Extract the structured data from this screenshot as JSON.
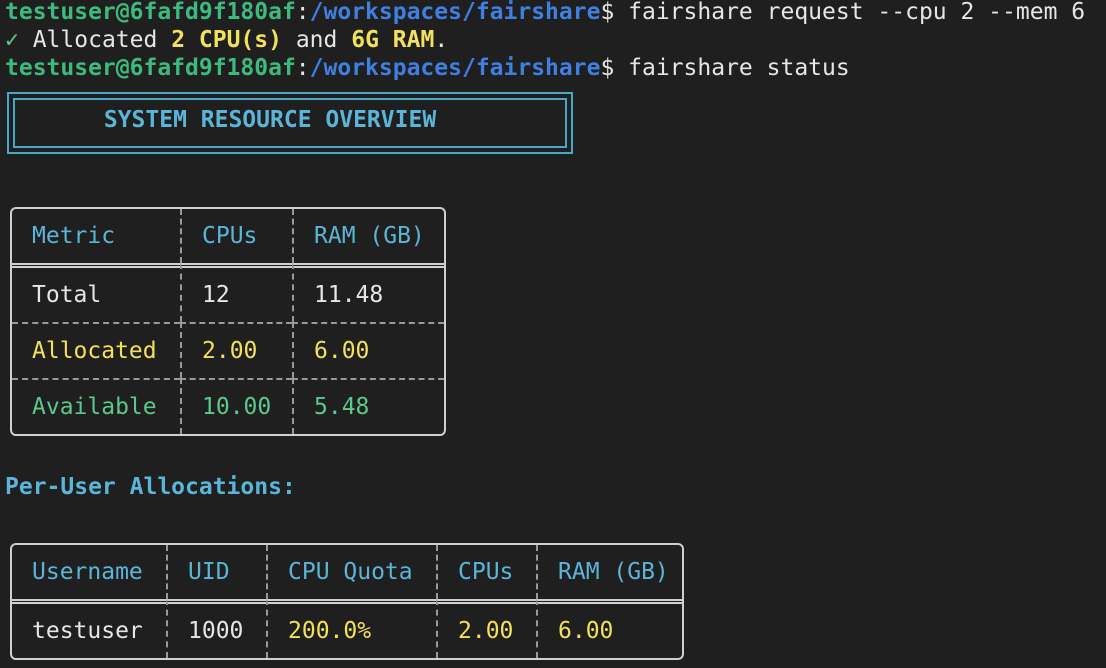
{
  "terminal": {
    "line1": {
      "user_host": "testuser@6fafd9f180af",
      "sep": ":",
      "path": "/workspaces/fairshare",
      "dollar": "$",
      "command": " fairshare request --cpu 2 --mem 6"
    },
    "line2": {
      "check": "✓",
      "text_a": " Allocated ",
      "cpu": "2 CPU(s)",
      "text_b": " and ",
      "ram": "6G RAM",
      "text_c": "."
    },
    "line3": {
      "user_host": "testuser@6fafd9f180af",
      "sep": ":",
      "path": "/workspaces/fairshare",
      "dollar": "$",
      "command": " fairshare status"
    }
  },
  "overview": {
    "title": "SYSTEM RESOURCE OVERVIEW",
    "headers": [
      "Metric",
      "CPUs",
      "RAM (GB)"
    ],
    "rows": [
      [
        "Total",
        "12",
        "11.48"
      ],
      [
        "Allocated",
        "2.00",
        "6.00"
      ],
      [
        "Available",
        "10.00",
        "5.48"
      ]
    ]
  },
  "per_user": {
    "title": "Per-User Allocations:",
    "headers": [
      "Username",
      "UID",
      "CPU Quota",
      "CPUs",
      "RAM (GB)"
    ],
    "rows": [
      [
        "testuser",
        "1000",
        "200.0%",
        "2.00",
        "6.00"
      ]
    ]
  },
  "colors": {
    "background": "#1f1f1f",
    "prompt_user": "#3dba7e",
    "prompt_path": "#3f7fe0",
    "header_cyan": "#5bb5d8",
    "highlight_yellow": "#f2e15b",
    "available_green": "#5cc98a"
  }
}
